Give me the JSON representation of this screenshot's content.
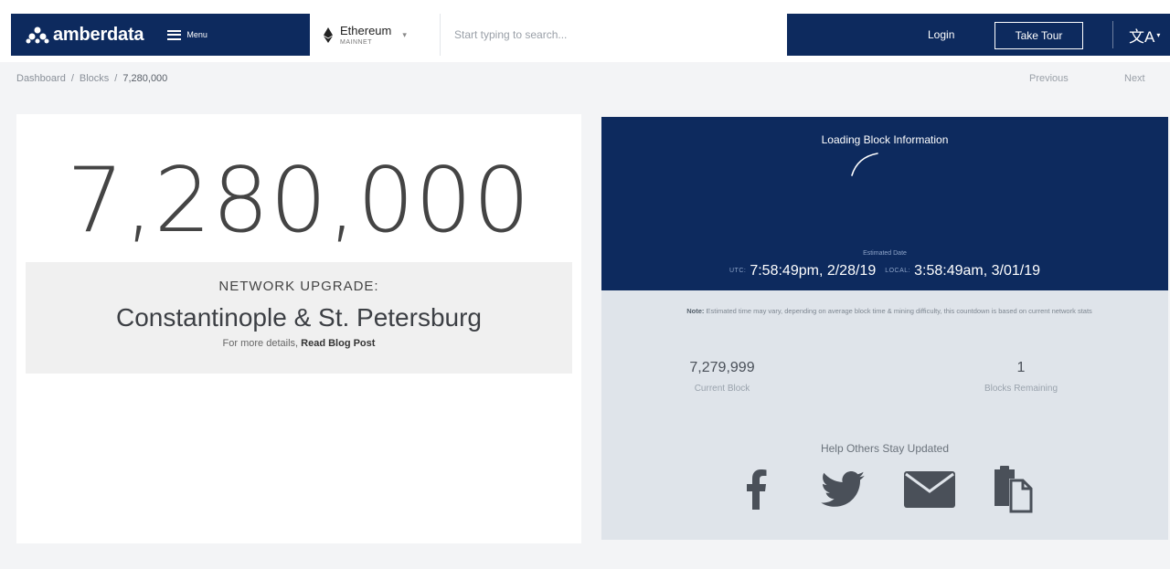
{
  "header": {
    "brand": "amberdata",
    "menu_label": "Menu",
    "network": {
      "name": "Ethereum",
      "sub": "MAINNET"
    },
    "search_placeholder": "Start typing to search...",
    "login_label": "Login",
    "tour_label": "Take Tour",
    "language_icon": "translate-icon",
    "colors": {
      "navy": "#0d2a5e",
      "white": "#ffffff"
    }
  },
  "breadcrumb": {
    "items": [
      "Dashboard",
      "Blocks",
      "7,280,000"
    ],
    "separator": "/"
  },
  "pager": {
    "previous": "Previous",
    "next": "Next"
  },
  "block": {
    "number": "7,280,000",
    "upgrade_label": "NETWORK UPGRADE:",
    "upgrade_name": "Constantinople & St. Petersburg",
    "more_prefix": "For more details,",
    "more_link": "Read Blog Post"
  },
  "countdown": {
    "loading_title": "Loading Block Information",
    "estimated_label": "Estimated Date",
    "utc_label": "UTC:",
    "utc_time": "7:58:49pm, 2/28/19",
    "local_label": "LOCAL:",
    "local_time": "3:58:49am, 3/01/19",
    "note_label": "Note:",
    "note_text": "Estimated time may vary, depending on average block time & mining difficulty, this countdown is based on current network stats",
    "current_block_value": "7,279,999",
    "current_block_label": "Current Block",
    "blocks_remaining_value": "1",
    "blocks_remaining_label": "Blocks Remaining",
    "share_title": "Help Others Stay Updated",
    "share_icons": [
      "facebook-icon",
      "twitter-icon",
      "email-icon",
      "copy-icon"
    ]
  }
}
